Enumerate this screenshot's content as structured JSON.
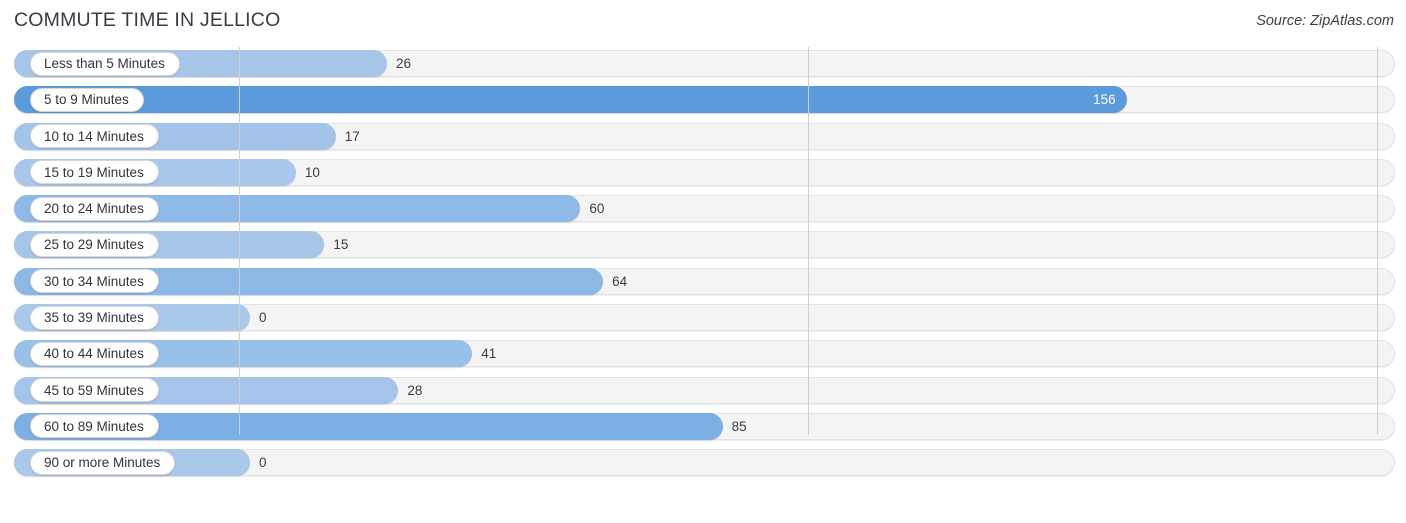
{
  "header": {
    "title": "COMMUTE TIME IN JELLICO",
    "source": "Source: ZipAtlas.com"
  },
  "chart_data": {
    "type": "bar",
    "orientation": "horizontal",
    "title": "COMMUTE TIME IN JELLICO",
    "xlabel": "",
    "ylabel": "",
    "xlim": [
      0,
      200
    ],
    "ticks": [
      "0",
      "100",
      "200"
    ],
    "tick_values": [
      0,
      100,
      200
    ],
    "grid": true,
    "legend": "none",
    "categories": [
      "Less than 5 Minutes",
      "5 to 9 Minutes",
      "10 to 14 Minutes",
      "15 to 19 Minutes",
      "20 to 24 Minutes",
      "25 to 29 Minutes",
      "30 to 34 Minutes",
      "35 to 39 Minutes",
      "40 to 44 Minutes",
      "45 to 59 Minutes",
      "60 to 89 Minutes",
      "90 or more Minutes"
    ],
    "values": [
      26,
      156,
      17,
      10,
      60,
      15,
      64,
      0,
      41,
      28,
      85,
      0
    ],
    "value_labels": [
      "26",
      "156",
      "17",
      "10",
      "60",
      "15",
      "64",
      "0",
      "41",
      "28",
      "85",
      "0"
    ],
    "bar_colors": [
      "#a6c5e9",
      "#5b9bdb",
      "#a3c3e8",
      "#a8c7ea",
      "#8fb9e6",
      "#a5c5e9",
      "#8db8e6",
      "#a9c8ea",
      "#99c0e7",
      "#a4c4e9",
      "#7cafe4",
      "#a9c8ea"
    ],
    "label_inside": [
      false,
      true,
      false,
      false,
      false,
      false,
      false,
      false,
      false,
      false,
      false,
      false
    ]
  },
  "style": {
    "track_bg": "#f4f4f5",
    "track_border": "#e3e3e5",
    "grid_color": "#cfcfcf",
    "pill_bg": "#ffffff",
    "text_color": "#33333d"
  }
}
